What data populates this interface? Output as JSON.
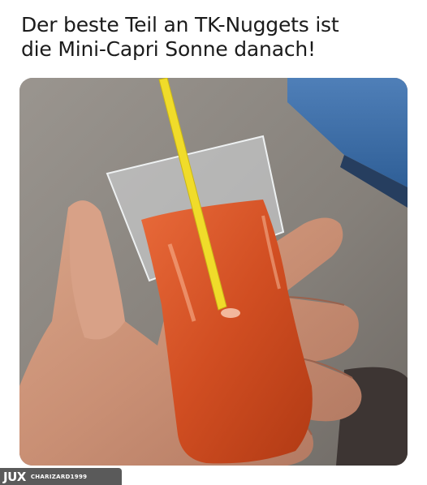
{
  "caption": {
    "line1": "Der beste Teil an TK-Nuggets ist",
    "line2": "die Mini-Capri Sonne danach!"
  },
  "watermark": {
    "logo": "9GAG-like logo",
    "logo_text": "JUX",
    "username": "CHARIZARD1999"
  },
  "photo": {
    "subject": "hand-holding-ketchup-pouch-with-straw"
  }
}
